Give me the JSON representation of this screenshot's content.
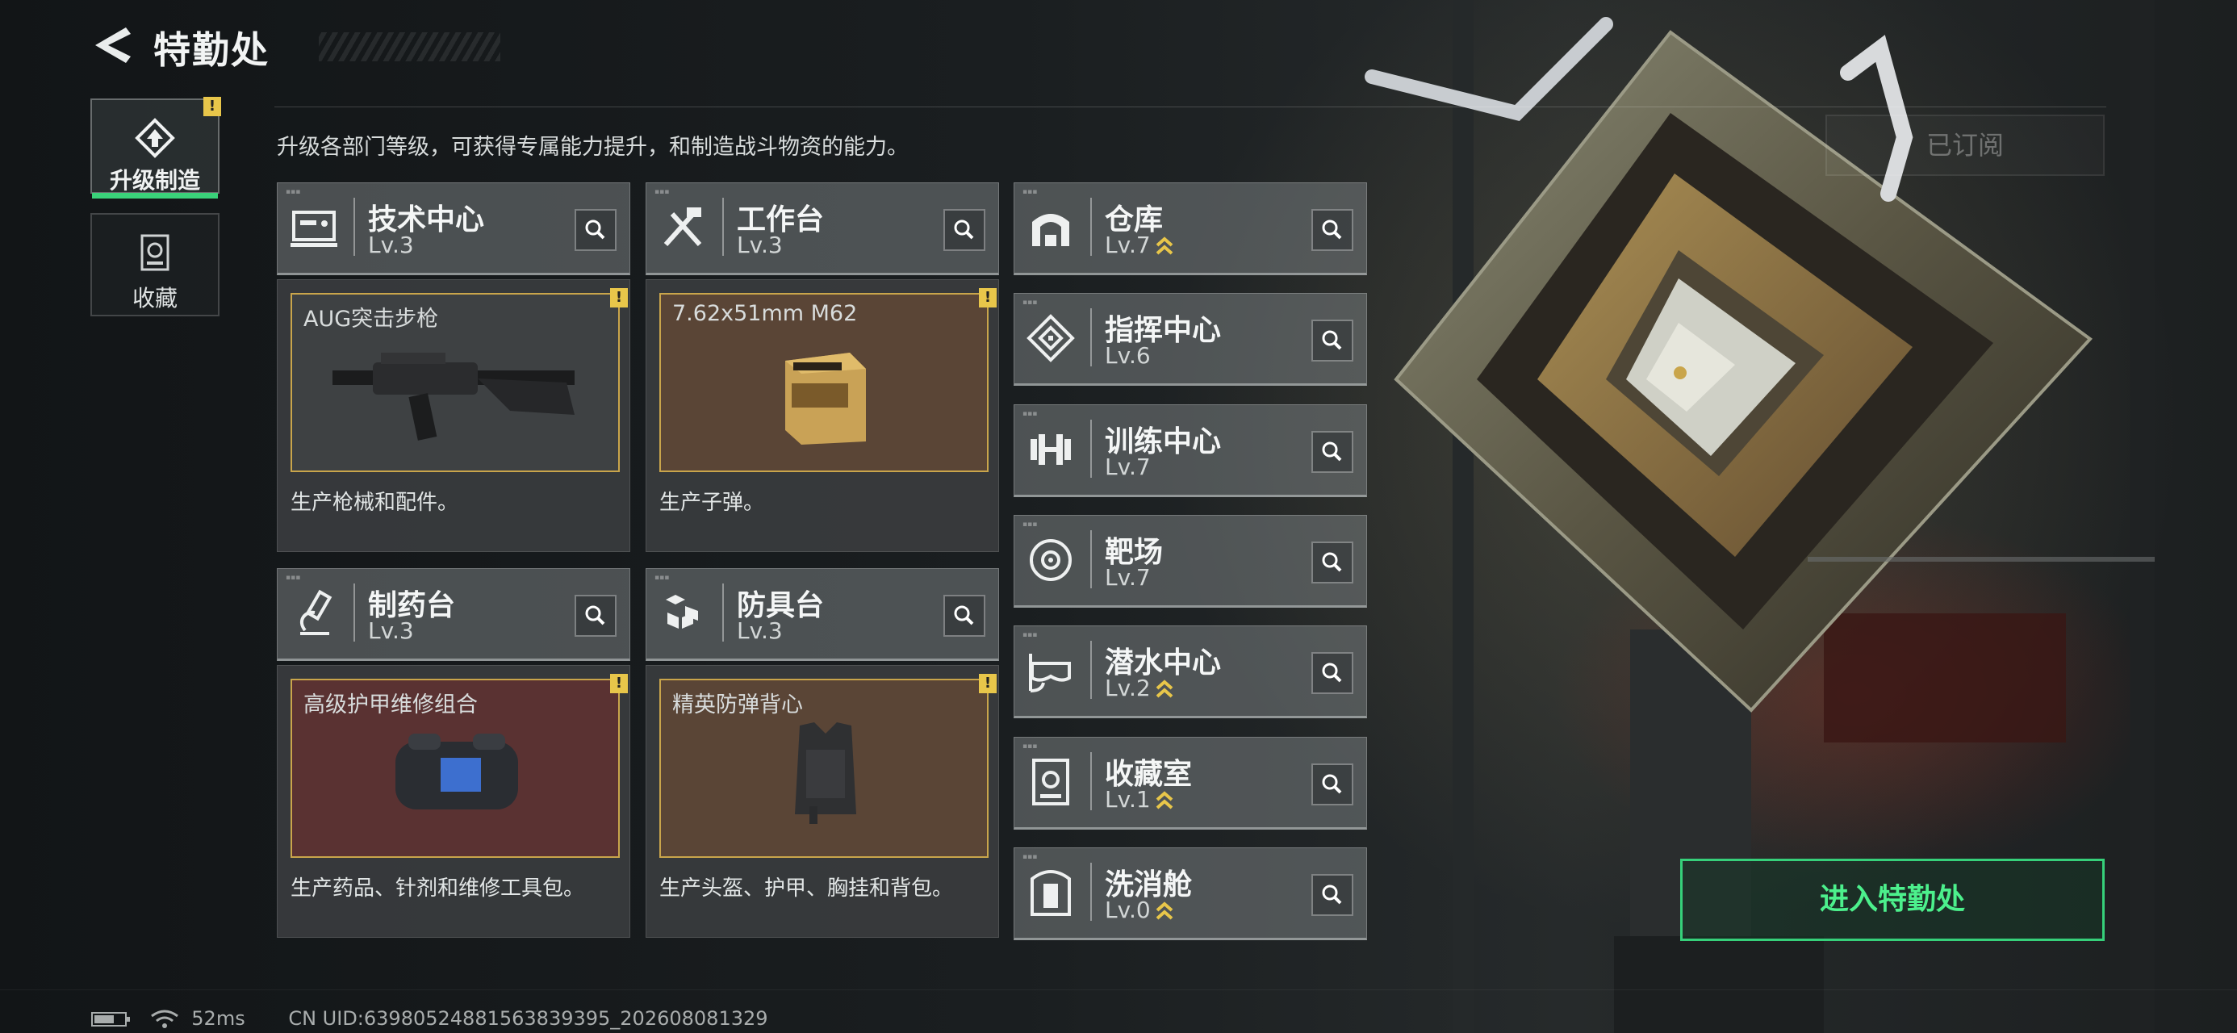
{
  "header": {
    "title": "特勤处"
  },
  "side_tabs": [
    {
      "label": "升级制造",
      "active": true,
      "icon": "upgrade-icon",
      "alert": "!"
    },
    {
      "label": "收藏",
      "active": false,
      "icon": "collection-icon"
    }
  ],
  "description": "升级各部门等级，可获得专属能力提升，和制造战斗物资的能力。",
  "subscribed_label": "已订阅",
  "production_cards": [
    {
      "name": "技术中心",
      "level": "Lv.3",
      "icon": "tech-center-icon",
      "item": "AUG突击步枪",
      "item_icon": "assault-rifle",
      "desc": "生产枪械和配件。",
      "alert": "!",
      "panel_color": "#3e4143"
    },
    {
      "name": "工作台",
      "level": "Lv.3",
      "icon": "workbench-icon",
      "item": "7.62x51mm M62",
      "item_icon": "ammo-box",
      "desc": "生产子弹。",
      "alert": "!",
      "panel_color": "#5a4536"
    },
    {
      "name": "制药台",
      "level": "Lv.3",
      "icon": "pharmacy-icon",
      "item": "高级护甲维修组合",
      "item_icon": "repair-kit-bag",
      "desc": "生产药品、针剂和维修工具包。",
      "alert": "!",
      "panel_color": "#5a3232"
    },
    {
      "name": "防具台",
      "level": "Lv.3",
      "icon": "armor-bench-icon",
      "item": "精英防弹背心",
      "item_icon": "armor-vest",
      "desc": "生产头盔、护甲、胸挂和背包。",
      "alert": "!",
      "panel_color": "#5a4536"
    }
  ],
  "departments": [
    {
      "name": "仓库",
      "level": "Lv.7",
      "upgradable": true,
      "icon": "warehouse-icon"
    },
    {
      "name": "指挥中心",
      "level": "Lv.6",
      "upgradable": false,
      "icon": "command-center-icon"
    },
    {
      "name": "训练中心",
      "level": "Lv.7",
      "upgradable": false,
      "icon": "training-center-icon"
    },
    {
      "name": "靶场",
      "level": "Lv.7",
      "upgradable": false,
      "icon": "shooting-range-icon"
    },
    {
      "name": "潜水中心",
      "level": "Lv.2",
      "upgradable": true,
      "icon": "diving-center-icon"
    },
    {
      "name": "收藏室",
      "level": "Lv.1",
      "upgradable": true,
      "icon": "collection-room-icon"
    },
    {
      "name": "洗消舱",
      "level": "Lv.0",
      "upgradable": true,
      "icon": "decon-chamber-icon"
    }
  ],
  "upgrade_marker": "≈",
  "enter_button": "进入特勤处",
  "footer": {
    "ping": "52ms",
    "uid": "CN UID:639805248815638393​95_202608081329"
  },
  "colors": {
    "accent_green": "#3ad27a",
    "item_border": "#c9a54b",
    "alert_yellow": "#e8c64a"
  }
}
